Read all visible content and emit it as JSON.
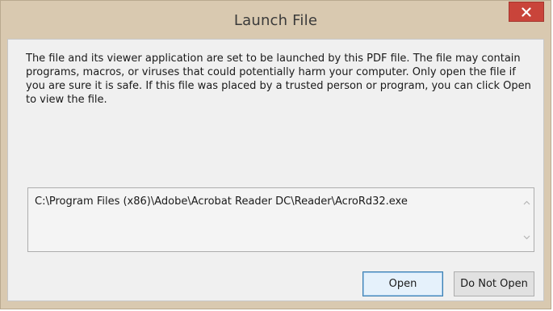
{
  "window": {
    "title": "Launch File"
  },
  "dialog": {
    "message": "The file and its viewer application are set to be launched by this PDF file. The file may contain programs, macros, or viruses that could potentially harm your computer. Only open the file if you are sure it is safe. If this file was placed by a trusted person or program, you can click Open to view the file.",
    "file_path": "C:\\Program Files (x86)\\Adobe\\Acrobat Reader DC\\Reader\\AcroRd32.exe"
  },
  "buttons": {
    "open_label": "Open",
    "do_not_open_label": "Do Not Open"
  },
  "icons": {
    "close": "close-icon",
    "scroll_up": "chevron-up-icon",
    "scroll_down": "chevron-down-icon"
  },
  "colors": {
    "frame": "#d9c9b0",
    "close_button": "#c9443a",
    "client_background": "#f0f0f0",
    "default_button_border": "#3c7fb1"
  }
}
